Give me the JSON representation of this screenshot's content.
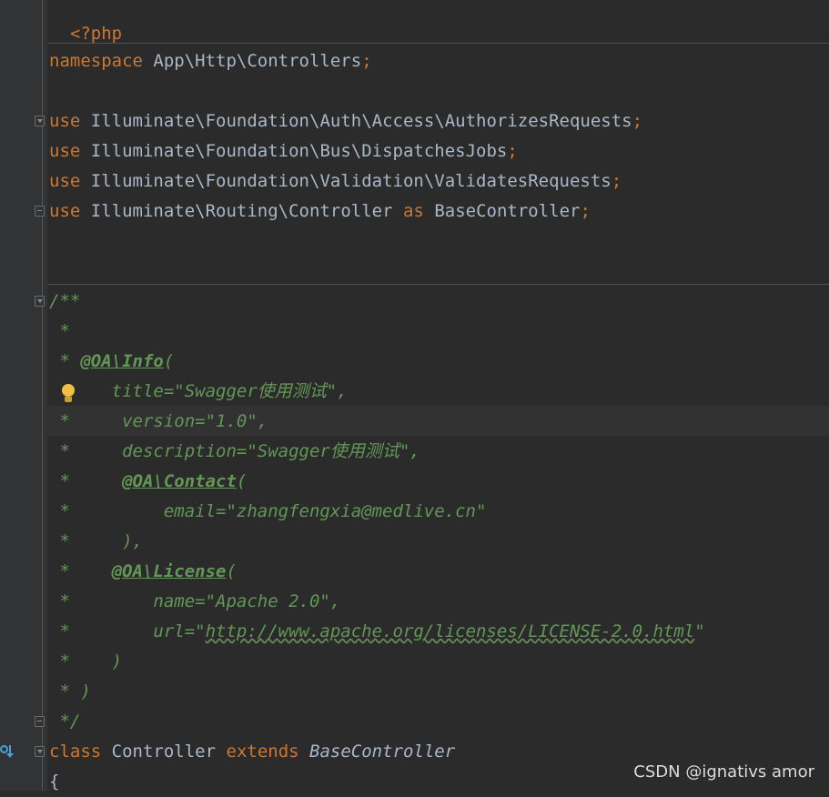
{
  "editor": {
    "lines": [
      {
        "id": "php-open",
        "text": "<?php"
      },
      {
        "id": "namespace",
        "kw": "namespace",
        "ns": "App\\Http\\Controllers",
        "semi": ";"
      },
      {
        "id": "use1",
        "kw": "use",
        "ns": "Illuminate\\Foundation\\Auth\\Access\\AuthorizesRequests",
        "semi": ";"
      },
      {
        "id": "use2",
        "kw": "use",
        "ns": "Illuminate\\Foundation\\Bus\\DispatchesJobs",
        "semi": ";"
      },
      {
        "id": "use3",
        "kw": "use",
        "ns": "Illuminate\\Foundation\\Validation\\ValidatesRequests",
        "semi": ";"
      },
      {
        "id": "use4",
        "kw": "use",
        "ns": "Illuminate\\Routing\\Controller",
        "as": "as",
        "alias": "BaseController",
        "semi": ";"
      }
    ],
    "doc": {
      "open": "/**",
      "star": " *",
      "info_prefix": " * ",
      "info_tag": "@OA\\Info",
      "paren_open": "(",
      "title_line": "      title=\"Swagger使用测试\",",
      "version_line": " *     version=\"1.0\",",
      "description_line": " *     description=\"Swagger使用测试\",",
      "contact_prefix": " *     ",
      "contact_tag": "@OA\\Contact",
      "email_line": " *         email=\"zhangfengxia@medlive.cn\"",
      "contact_close": " *     ),",
      "license_prefix": " *    ",
      "license_tag": "@OA\\License",
      "name_line": " *        name=\"Apache 2.0\",",
      "url_prefix": " *        url=\"",
      "url": "http://www.apache.org/licenses/LICENSE-2.0.html",
      "url_suffix": "\"",
      "license_close": " *    )",
      "info_close": " * )",
      "close": " */"
    },
    "class_line": {
      "kw_class": "class",
      "name": "Controller",
      "kw_extends": "extends",
      "parent": "BaseController"
    },
    "brace": "{"
  },
  "icons": {
    "bulb": "intention-bulb-icon",
    "gutter": "implementation-gutter-icon"
  },
  "watermark": "CSDN @ignativs  amor",
  "colors": {
    "background": "#2b2b2b",
    "keyword": "#cc7832",
    "text": "#a9b7c6",
    "doc": "#629755"
  }
}
